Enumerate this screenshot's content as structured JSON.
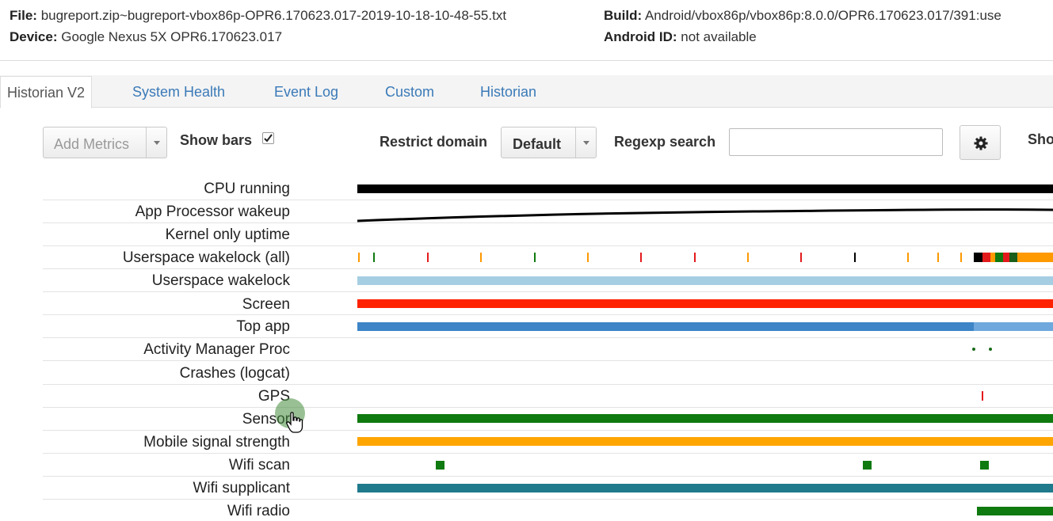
{
  "header": {
    "file_label": "File:",
    "file_value": "bugreport.zip~bugreport-vbox86p-OPR6.170623.017-2019-10-18-10-48-55.txt",
    "device_label": "Device:",
    "device_value": "Google Nexus 5X OPR6.170623.017",
    "build_label": "Build:",
    "build_value": "Android/vbox86p/vbox86p:8.0.0/OPR6.170623.017/391:use",
    "android_id_label": "Android ID:",
    "android_id_value": "not available"
  },
  "tabs": [
    {
      "label": "Historian V2",
      "active": true
    },
    {
      "label": "System Health",
      "active": false
    },
    {
      "label": "Event Log",
      "active": false
    },
    {
      "label": "Custom",
      "active": false
    },
    {
      "label": "Historian",
      "active": false
    }
  ],
  "controls": {
    "add_metrics_placeholder": "Add Metrics",
    "show_bars_label": "Show bars",
    "show_bars_checked": true,
    "restrict_domain_label": "Restrict domain",
    "restrict_domain_value": "Default",
    "regexp_search_label": "Regexp search",
    "regexp_search_value": "",
    "settings_icon": "gear-icon",
    "show_label_truncated": "Sho"
  },
  "metrics": [
    {
      "label": "CPU running",
      "color": "#000000"
    },
    {
      "label": "App Processor wakeup",
      "color": "#000000"
    },
    {
      "label": "Kernel only uptime",
      "color": ""
    },
    {
      "label": "Userspace wakelock (all)",
      "color": "#ff9900"
    },
    {
      "label": "Userspace wakelock",
      "color": "#a6cee3"
    },
    {
      "label": "Screen",
      "color": "#ff2200"
    },
    {
      "label": "Top app",
      "color": "#3d85c6"
    },
    {
      "label": "Activity Manager Proc",
      "color": "#1a6b1a"
    },
    {
      "label": "Crashes (logcat)",
      "color": ""
    },
    {
      "label": "GPS",
      "color": "#e31a1c"
    },
    {
      "label": "Sensor",
      "color": "#0f7a0f"
    },
    {
      "label": "Mobile signal strength",
      "color": "#ffa500"
    },
    {
      "label": "Wifi scan",
      "color": "#0f7a0f"
    },
    {
      "label": "Wifi supplicant",
      "color": "#1f7a8c"
    },
    {
      "label": "Wifi radio",
      "color": "#0f7a0f"
    }
  ]
}
